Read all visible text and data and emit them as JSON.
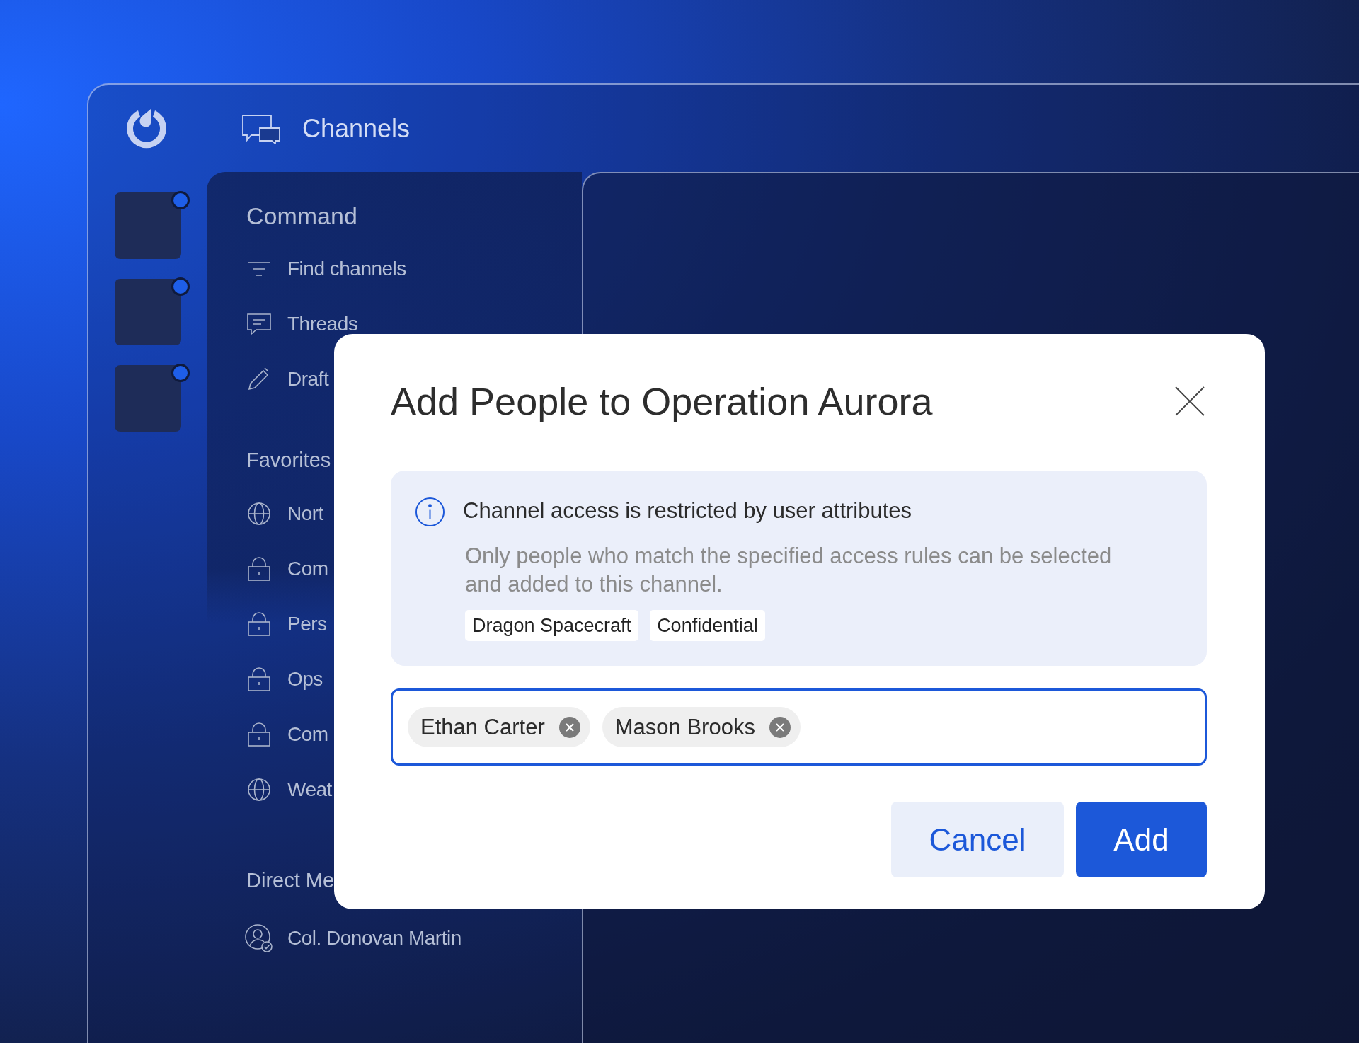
{
  "header": {
    "title": "Channels"
  },
  "teams": [
    {
      "unread": true
    },
    {
      "unread": true
    },
    {
      "unread": true
    }
  ],
  "sidebar": {
    "heading": "Command",
    "nav": [
      {
        "kind": "filter",
        "label": "Find channels"
      },
      {
        "kind": "chat",
        "label": "Threads"
      },
      {
        "kind": "pencil",
        "label": "Draft"
      }
    ],
    "sections": [
      {
        "title": "Favorites",
        "items": [
          {
            "kind": "public",
            "label": "Nort"
          },
          {
            "kind": "private",
            "label": "Com"
          },
          {
            "kind": "private",
            "label": "Pers"
          },
          {
            "kind": "private",
            "label": "Ops"
          },
          {
            "kind": "private",
            "label": "Com"
          },
          {
            "kind": "public",
            "label": "Weat"
          }
        ]
      },
      {
        "title": "Direct Me",
        "items": [
          {
            "kind": "dm",
            "label": "Col. Donovan Martin"
          }
        ]
      }
    ]
  },
  "dialog": {
    "title": "Add People to Operation Aurora",
    "notice": {
      "heading": "Channel access is restricted by user attributes",
      "body": "Only people who match the specified access rules can be selected and added to this channel.",
      "tags": [
        "Dragon Spacecraft",
        "Confidential"
      ]
    },
    "selected_people": [
      "Ethan Carter",
      "Mason Brooks"
    ],
    "buttons": [
      {
        "kind": "secondary",
        "label": "Cancel"
      },
      {
        "kind": "primary",
        "label": "Add"
      }
    ]
  }
}
